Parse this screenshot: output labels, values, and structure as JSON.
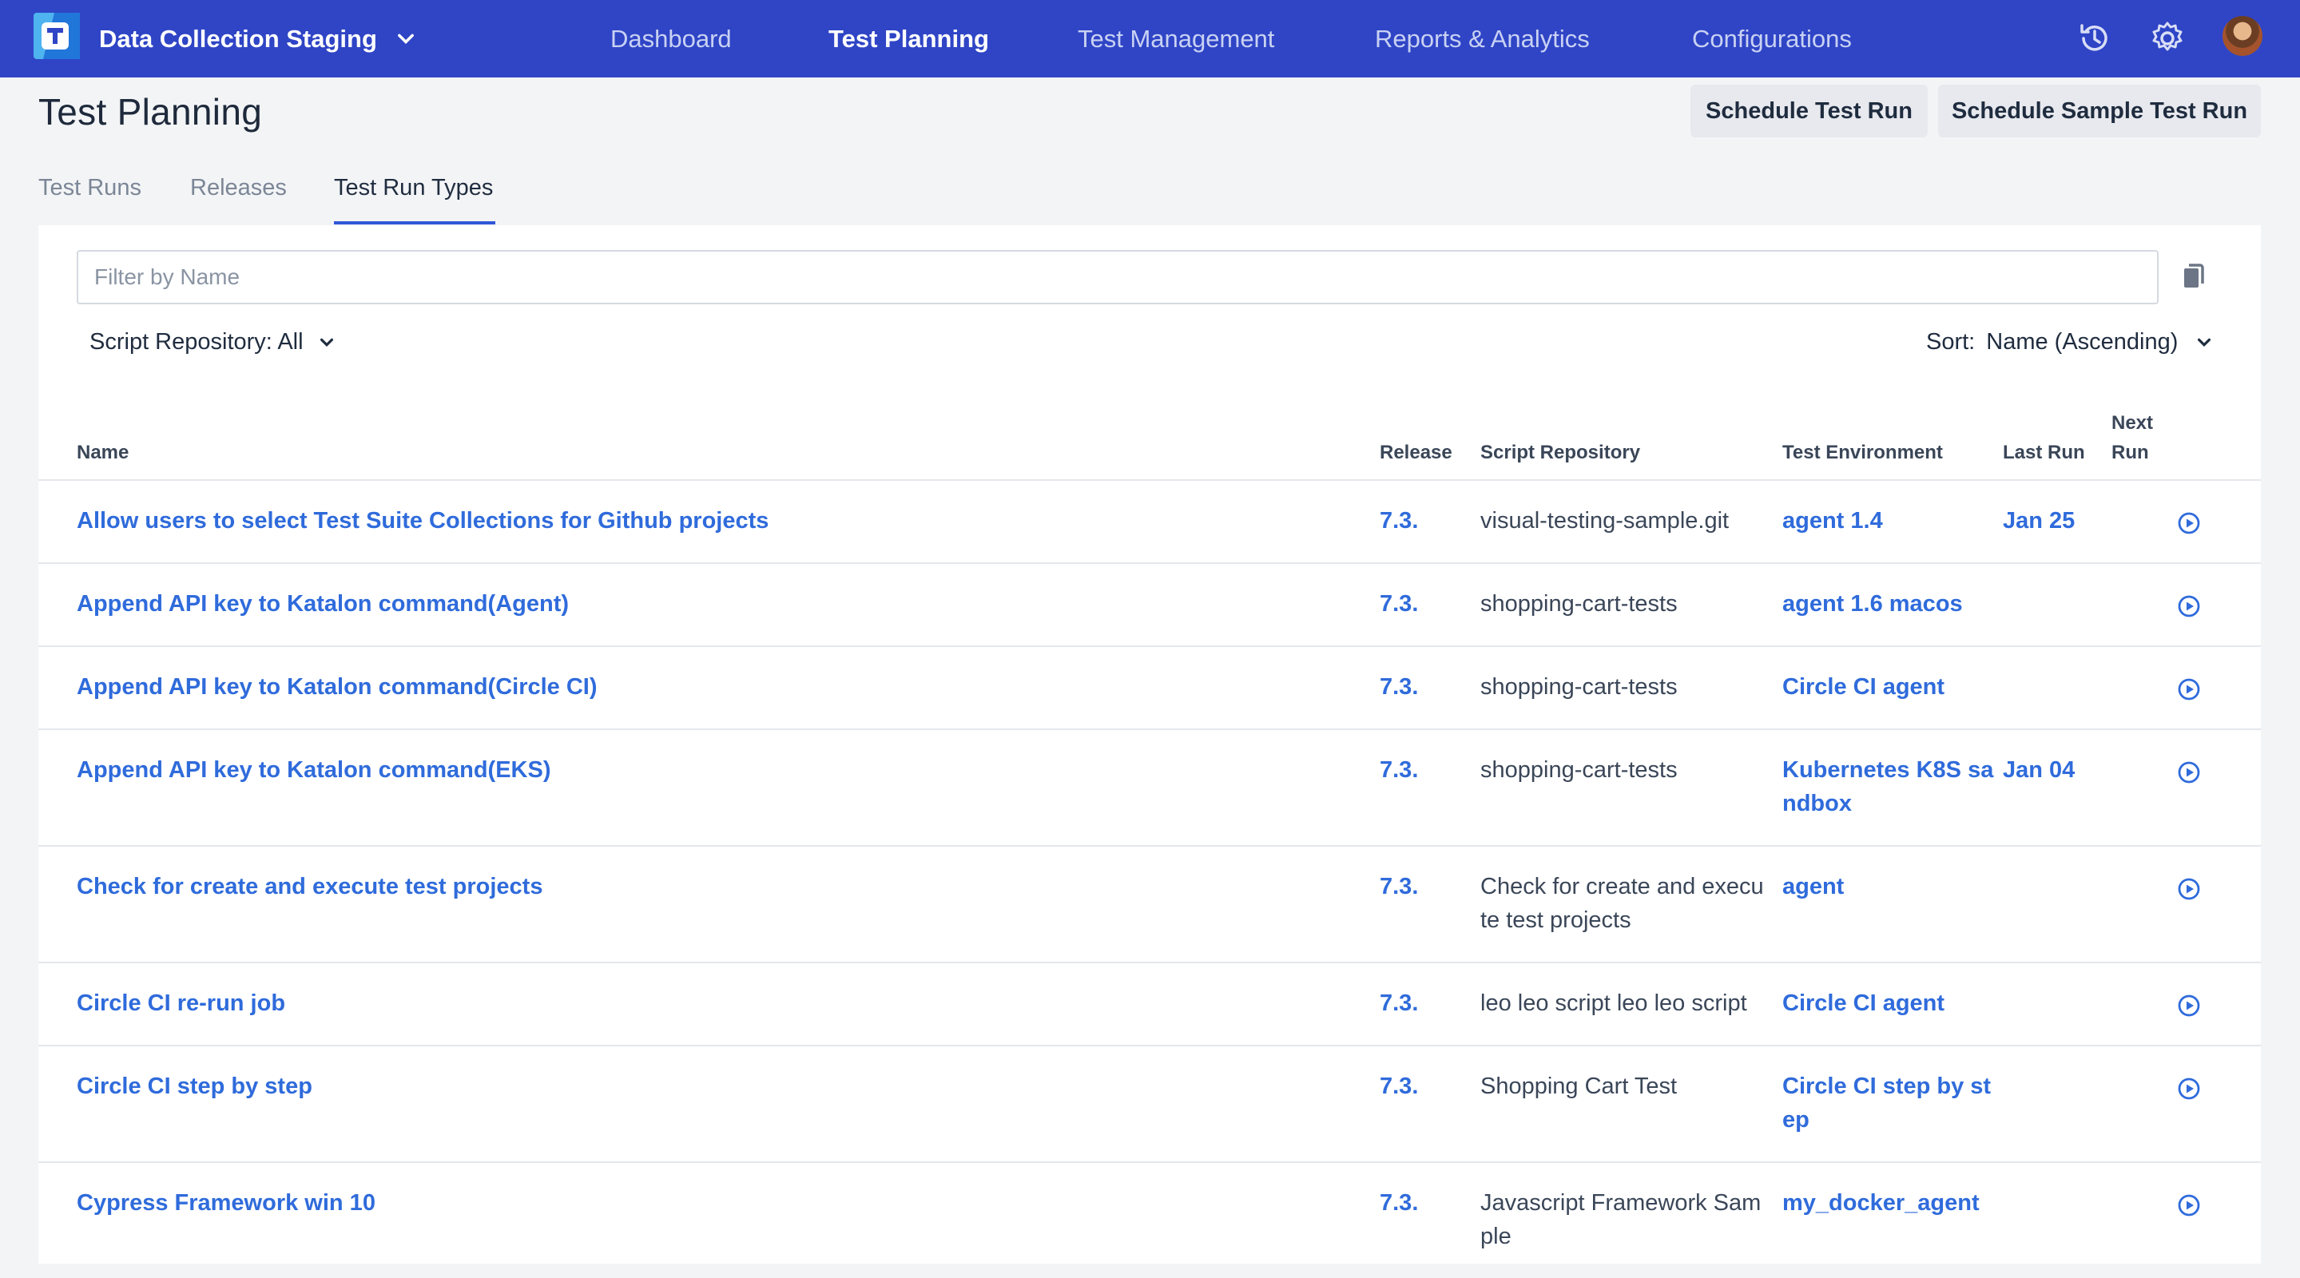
{
  "header": {
    "project_name": "Data Collection Staging",
    "nav": [
      "Dashboard",
      "Test Planning",
      "Test Management",
      "Reports & Analytics",
      "Configurations"
    ],
    "active_nav": "Test Planning",
    "icons": [
      "history-icon",
      "settings-icon",
      "user-avatar"
    ],
    "brand_color": "#2f45c6"
  },
  "page": {
    "title": "Test Planning",
    "buttons": [
      "Schedule Test Run",
      "Schedule Sample Test Run"
    ],
    "tabs": [
      "Test Runs",
      "Releases",
      "Test Run Types"
    ],
    "active_tab": "Test Run Types"
  },
  "filters": {
    "placeholder": "Filter by Name",
    "script_repository": "Script Repository: All",
    "sort_label": "Sort:",
    "sort_value": "Name (Ascending)"
  },
  "table": {
    "columns": [
      "Name",
      "Release",
      "Script Repository",
      "Test Environment",
      "Last Run",
      "Next",
      "Run"
    ],
    "rows": [
      {
        "name": "Allow users to select Test Suite Collections for Github projects",
        "release": "7.3.",
        "repo1": "visual-testing-sample.git",
        "repo2": "",
        "env1": "agent 1.4",
        "env2": "",
        "last_run": "Jan 25"
      },
      {
        "name": "Append API key to Katalon command(Agent)",
        "release": "7.3.",
        "repo1": "shopping-cart-tests",
        "repo2": "",
        "env1": "agent 1.6 macos",
        "env2": "",
        "last_run": ""
      },
      {
        "name": "Append API key to Katalon command(Circle CI)",
        "release": "7.3.",
        "repo1": "shopping-cart-tests",
        "repo2": "",
        "env1": "Circle CI agent",
        "env2": "",
        "last_run": ""
      },
      {
        "name": "Append API key to Katalon command(EKS)",
        "release": "7.3.",
        "repo1": "shopping-cart-tests",
        "repo2": "",
        "env1": "Kubernetes K8S sa",
        "env2": "ndbox",
        "last_run": "Jan 04"
      },
      {
        "name": "Check for create and execute test projects",
        "release": "7.3.",
        "repo1": "Check for create and execu",
        "repo2": "te test projects",
        "env1": "agent",
        "env2": "",
        "last_run": ""
      },
      {
        "name": "Circle CI re-run job",
        "release": "7.3.",
        "repo1": "leo leo script leo leo script",
        "repo2": "",
        "env1": "Circle CI agent",
        "env2": "",
        "last_run": ""
      },
      {
        "name": "Circle CI step by step",
        "release": "7.3.",
        "repo1": "Shopping Cart Test",
        "repo2": "",
        "env1": "Circle CI step by st",
        "env2": "ep",
        "last_run": ""
      },
      {
        "name": "Cypress Framework win 10",
        "release": "7.3.",
        "repo1": "Javascript Framework Sam",
        "repo2": "ple",
        "env1": "my_docker_agent",
        "env2": "",
        "last_run": ""
      }
    ]
  }
}
